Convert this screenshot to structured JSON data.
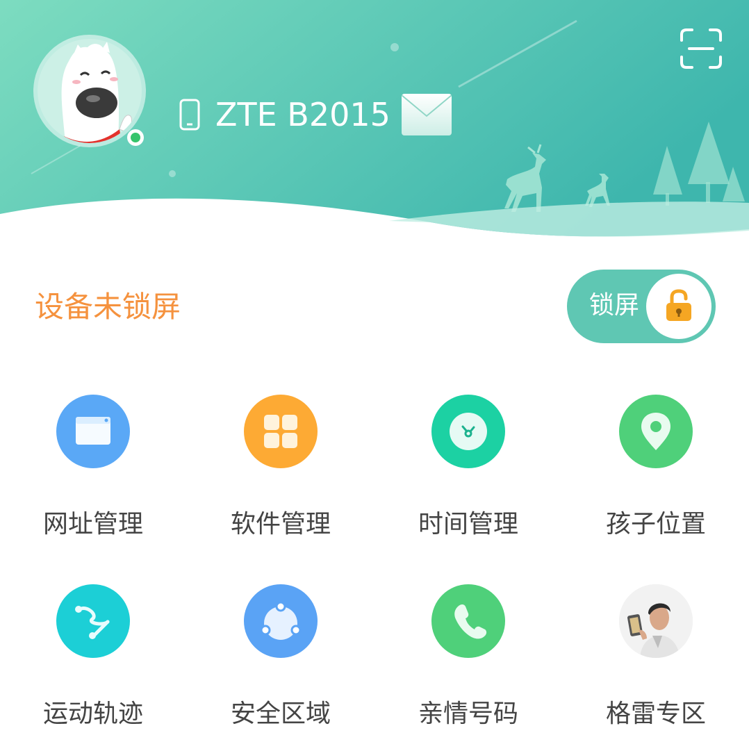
{
  "header": {
    "device_name": "ZTE B2015",
    "colors": {
      "gradient_start": "#7ddcc0",
      "gradient_end": "#3fb8ad"
    },
    "icons": {
      "avatar": "dog-mascot-icon",
      "device": "phone-icon",
      "message": "mail-icon",
      "scan": "scan-icon"
    }
  },
  "lock": {
    "status_text": "设备未锁屏",
    "toggle_label": "锁屏",
    "status_color": "#f5923e",
    "icon": "unlocked-padlock-icon"
  },
  "features": [
    {
      "label": "网址管理",
      "icon": "browser-window-icon",
      "color": "#5aa8f6"
    },
    {
      "label": "软件管理",
      "icon": "app-grid-icon",
      "color": "#fdaa34"
    },
    {
      "label": "时间管理",
      "icon": "clock-icon",
      "color": "#1cd1a3"
    },
    {
      "label": "孩子位置",
      "icon": "location-pin-icon",
      "color": "#4fd07a"
    },
    {
      "label": "运动轨迹",
      "icon": "route-icon",
      "color": "#1ccfd6"
    },
    {
      "label": "安全区域",
      "icon": "safe-zone-icon",
      "color": "#5aa3f5"
    },
    {
      "label": "亲情号码",
      "icon": "phone-call-icon",
      "color": "#4fd07a"
    },
    {
      "label": "格雷专区",
      "icon": "promo-photo-icon",
      "color": "#d8d8d8"
    }
  ]
}
